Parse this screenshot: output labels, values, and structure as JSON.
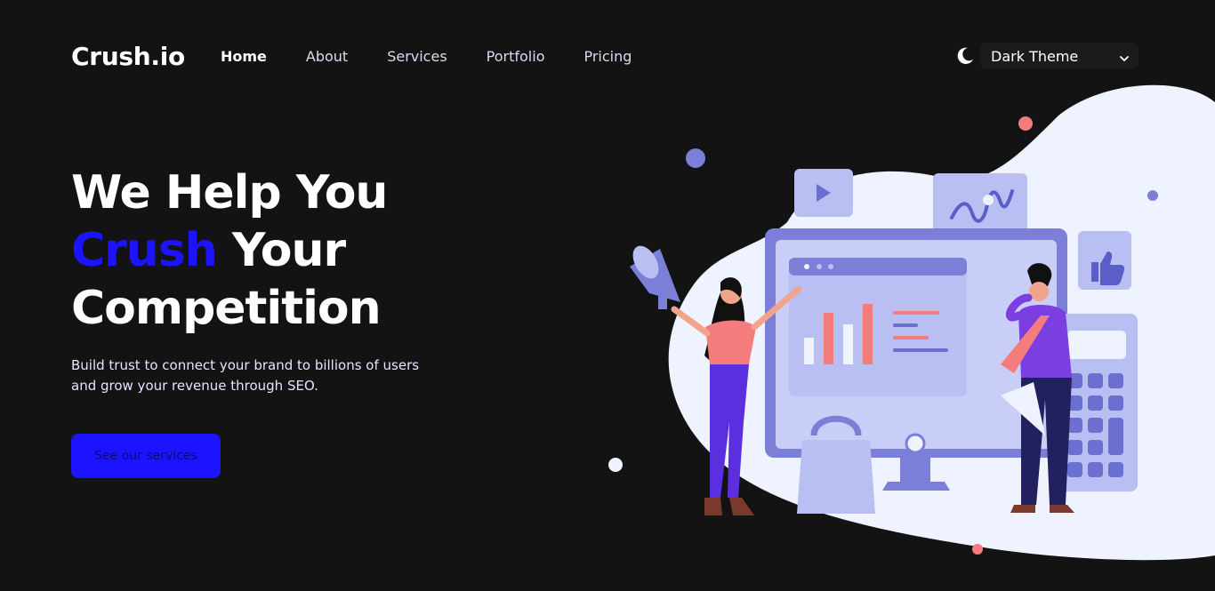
{
  "header": {
    "logo": "Crush.io",
    "nav": [
      {
        "label": "Home",
        "active": true
      },
      {
        "label": "About"
      },
      {
        "label": "Services"
      },
      {
        "label": "Portfolio"
      },
      {
        "label": "Pricing"
      }
    ],
    "theme": {
      "icon": "moon-icon",
      "selected": "Dark Theme"
    }
  },
  "hero": {
    "headline_line1": "We Help You",
    "headline_accent": "Crush",
    "headline_line2_rest": " Your",
    "headline_line3": "Competition",
    "description": "Build trust to connect your brand to billions of users and grow your revenue through SEO.",
    "cta_label": "See our services"
  },
  "colors": {
    "background": "#131313",
    "accent": "#1d14ff",
    "blob": "#eef3ff",
    "illustration_primary": "#7b7fd8",
    "illustration_light": "#b9bff2",
    "coral": "#f57c7c"
  }
}
